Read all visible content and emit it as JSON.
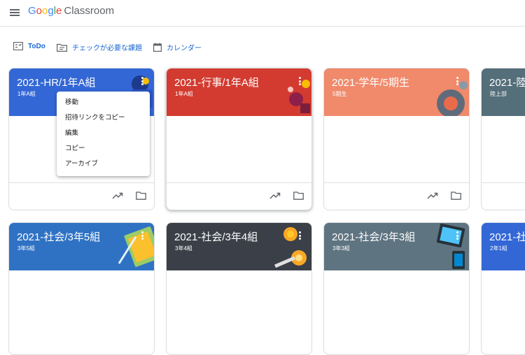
{
  "app": {
    "logo_google": [
      "G",
      "o",
      "o",
      "g",
      "l",
      "e"
    ],
    "logo_product": "Classroom"
  },
  "nav_links": [
    {
      "label": "ToDo",
      "icon": "todo-list-icon"
    },
    {
      "label": "チェックが必要な課題",
      "icon": "folder-review-icon"
    },
    {
      "label": "カレンダー",
      "icon": "calendar-icon"
    }
  ],
  "cards": [
    {
      "title": "2021-HR/1年A組",
      "subtitle": "1年A組",
      "color": "#3367d6"
    },
    {
      "title": "2021-行事/1年A組",
      "subtitle": "1年A組",
      "color": "#d33b30"
    },
    {
      "title": "2021-学年/5期生",
      "subtitle": "5期生",
      "color": "#f08a6b"
    },
    {
      "title": "2021-陸",
      "subtitle": "陸上部",
      "color": "#546e7a"
    },
    {
      "title": "2021-社会/3年5組",
      "subtitle": "3年5組",
      "color": "#2f72c4"
    },
    {
      "title": "2021-社会/3年4組",
      "subtitle": "3年4組",
      "color": "#3b4048"
    },
    {
      "title": "2021-社会/3年3組",
      "subtitle": "3年3組",
      "color": "#5f7481"
    },
    {
      "title": "2021-社",
      "subtitle": "2年1組",
      "color": "#3367d6"
    }
  ],
  "context_menu": [
    "移動",
    "招待リンクをコピー",
    "編集",
    "コピー",
    "アーカイブ"
  ],
  "icons": {
    "menu": "hamburger-menu-icon",
    "trend": "trending-up-icon",
    "folder": "folder-icon",
    "more": "more-vert-icon"
  }
}
